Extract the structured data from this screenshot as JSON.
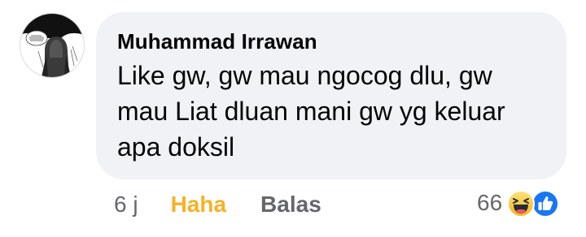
{
  "comment": {
    "author": "Muhammad Irrawan",
    "text": "Like gw, gw mau ngocog dlu, gw mau Liat dluan mani gw yg keluar apa doksil",
    "time": "6 j",
    "reaction_label": "Haha",
    "reply_label": "Balas",
    "reaction_count": "66",
    "reaction_icons": [
      "haha-icon",
      "like-icon"
    ],
    "colors": {
      "bubble": "#f0f2f5",
      "haha_text": "#f7b125",
      "secondary_text": "#65676b",
      "like_blue": "#1877f2"
    }
  }
}
